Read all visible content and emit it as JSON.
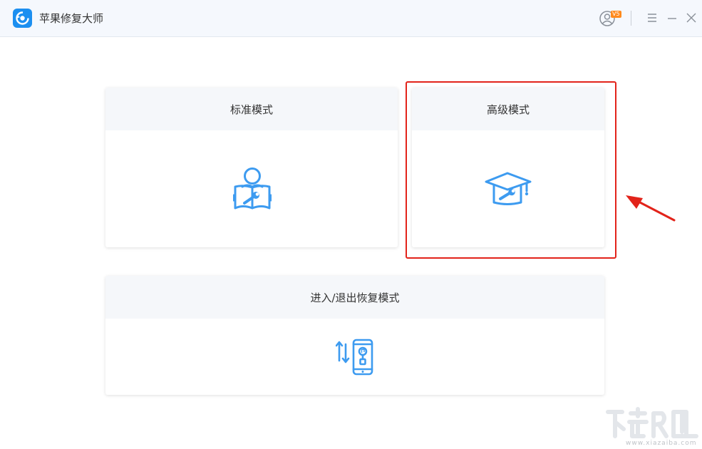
{
  "app": {
    "title": "苹果修复大师",
    "vip_badge": "V5"
  },
  "titlebar_icons": {
    "logo": "app-logo-icon",
    "user": "user-avatar-icon",
    "menu": "menu-icon",
    "minimize": "minimize-icon",
    "close": "close-icon"
  },
  "modes": {
    "standard": {
      "label": "标准模式",
      "icon": "reader-wrench-icon"
    },
    "advanced": {
      "label": "高级模式",
      "icon": "graduation-cap-wrench-icon"
    },
    "recovery": {
      "label": "进入/退出恢复模式",
      "icon": "phone-recovery-icon"
    }
  },
  "annotation": {
    "highlight_color": "#e2231a"
  },
  "watermark": {
    "url": "www.xiazaiba.com"
  },
  "colors": {
    "accent": "#3d9bf0",
    "titlebar_bg": "#f5f8fd",
    "card_header_bg": "#f5f7fa"
  }
}
